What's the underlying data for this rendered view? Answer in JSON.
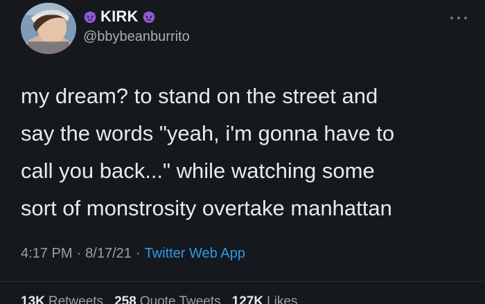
{
  "user": {
    "display_name": "KIRK",
    "handle": "@bbybeanburrito"
  },
  "icons": {
    "avatar": "profile-photo",
    "name_emoji_left": "angry-devil-emoji",
    "name_emoji_right": "angry-devil-emoji",
    "more": "more-options-icon"
  },
  "tweet": {
    "text": "my dream? to stand on the street and\nsay the words \"yeah, i'm gonna have to\ncall you back...\" while watching some\nsort of monstrosity overtake manhattan"
  },
  "meta": {
    "time": "4:17 PM",
    "separator1": "·",
    "date": "8/17/21",
    "separator2": "·",
    "app": "Twitter Web App"
  },
  "stats": {
    "retweets_count": "13K",
    "retweets_label": "Retweets",
    "quotes_count": "258",
    "quotes_label": "Quote Tweets",
    "likes_count": "127K",
    "likes_label": "Likes"
  },
  "colors": {
    "background": "#15181d",
    "text": "#e8eaeb",
    "muted": "#9aa3ab",
    "link": "#2f9be6",
    "emoji": "#8f5bd6"
  }
}
